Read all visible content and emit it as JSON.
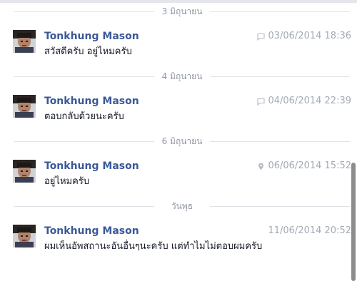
{
  "separators": [
    "3 มิถุนายน",
    "4 มิถุนายน",
    "6 มิถุนายน",
    "วันพุธ"
  ],
  "messages": [
    {
      "sender": "Tonkhung Mason",
      "text": "สวัสดีครับ อยู่ไหมครับ",
      "timestamp": "03/06/2014 18:36",
      "icon": "chat-bubble-icon"
    },
    {
      "sender": "Tonkhung Mason",
      "text": "ตอบกลับด้วยนะครับ",
      "timestamp": "04/06/2014 22:39",
      "icon": "chat-bubble-icon"
    },
    {
      "sender": "Tonkhung Mason",
      "text": "อยู่ไหมครับ",
      "timestamp": "06/06/2014 15:52",
      "icon": "location-pin-icon"
    },
    {
      "sender": "Tonkhung Mason",
      "text": "ผมเห็นอัพสถานะอันอื่นๆนะครับ แต่ทำไมไม่ตอบผมครับ",
      "timestamp": "11/06/2014 20:52",
      "icon": ""
    }
  ],
  "colors": {
    "sender_name": "#3b5998",
    "meta_text": "#a4aab5",
    "separator_text": "#9197a3"
  }
}
